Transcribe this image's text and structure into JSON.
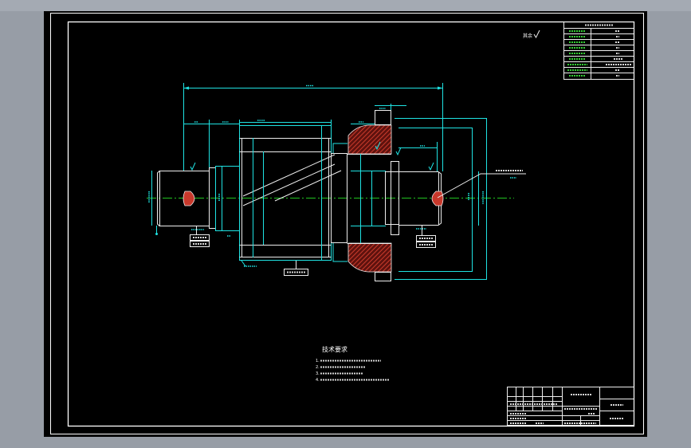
{
  "palette": {
    "app_background": "#979da6",
    "canvas": "#000000",
    "frame": "#ffffff",
    "outline": "#eeeeee",
    "dimension": "#1fe3e3",
    "centerline": "#21c421",
    "section_hatch": "#c8382b",
    "table_label": "#33cc33"
  },
  "drawing": {
    "roughness_note": "其余",
    "technical_requirements": {
      "title": "技术要求",
      "item_numbers": [
        "1.",
        "2.",
        "3.",
        "4."
      ]
    }
  }
}
